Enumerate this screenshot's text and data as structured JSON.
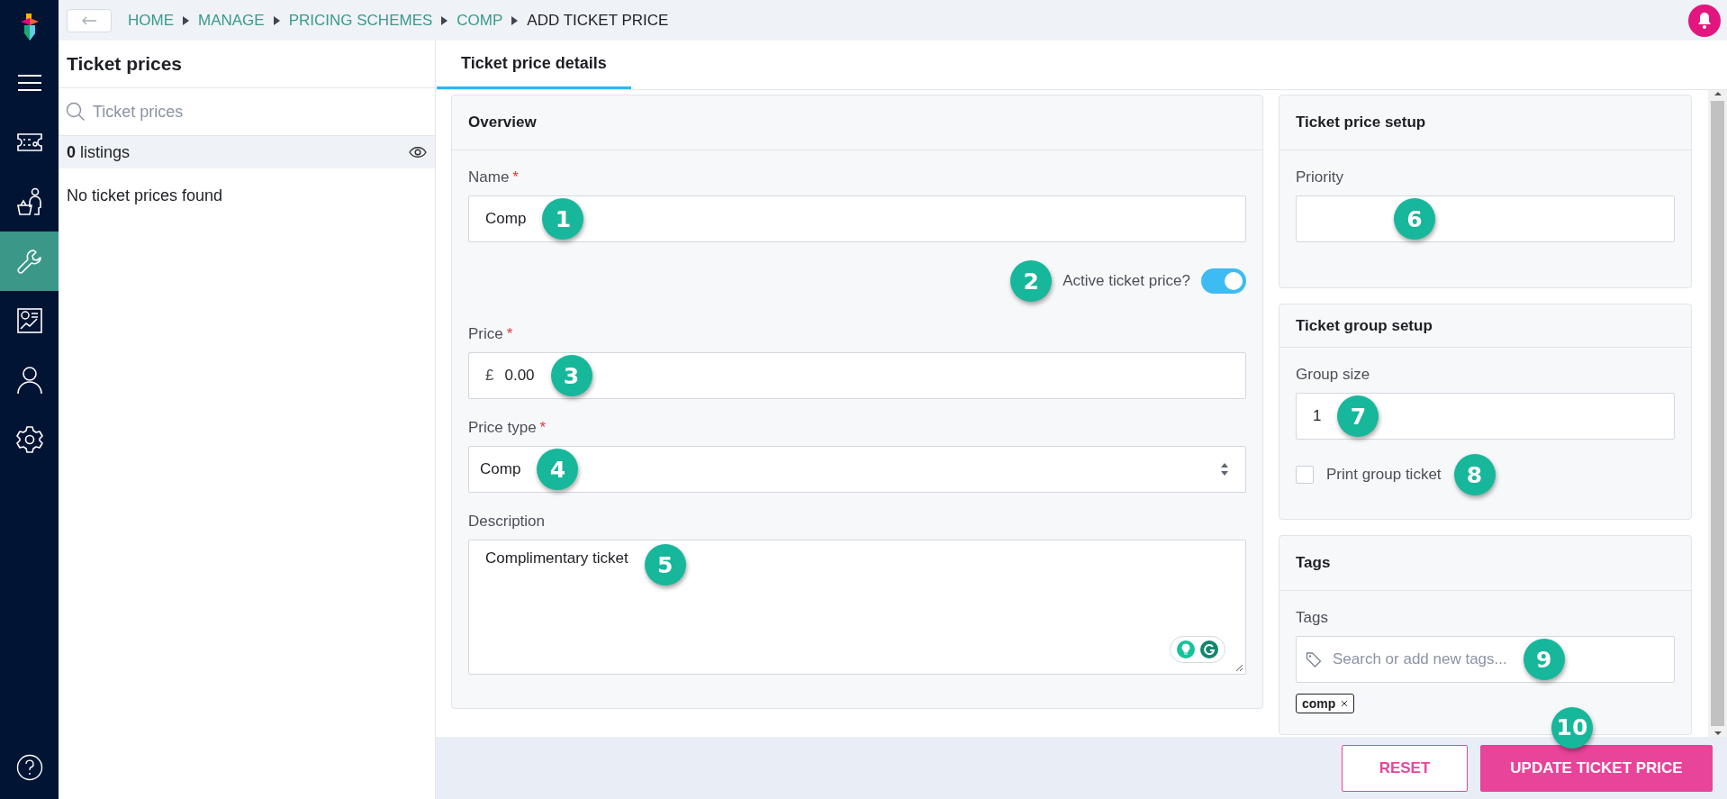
{
  "nav_items": [
    {
      "kind": "menu",
      "selected": false
    },
    {
      "kind": "ticket",
      "selected": false
    },
    {
      "kind": "basket",
      "selected": false
    },
    {
      "kind": "wrench",
      "selected": true
    },
    {
      "kind": "report",
      "selected": false
    },
    {
      "kind": "person",
      "selected": false
    },
    {
      "kind": "settings",
      "selected": false
    },
    {
      "kind": "help",
      "selected": false
    }
  ],
  "breadcrumbs": [
    {
      "label": "HOME",
      "current": false
    },
    {
      "label": "MANAGE",
      "current": false
    },
    {
      "label": "PRICING SCHEMES",
      "current": false
    },
    {
      "label": "COMP",
      "current": false
    },
    {
      "label": "ADD TICKET PRICE",
      "current": true
    }
  ],
  "list_panel": {
    "title": "Ticket prices",
    "search_placeholder": "Ticket prices",
    "count": "**0** listings",
    "empty_text": "No ticket prices found"
  },
  "tabs": [
    {
      "label": "Ticket price details",
      "selected": true
    }
  ],
  "overview": {
    "title": "Overview",
    "fields": [
      {
        "kind": "text",
        "label": "Name",
        "required_mark": "*",
        "value": "Comp",
        "callout": "1"
      },
      {
        "kind": "toggle",
        "label": "Active ticket price?",
        "on": true,
        "callout": "2"
      },
      {
        "kind": "currency",
        "label": "Price",
        "required_mark": "*",
        "prefix": "£",
        "value": "0.00",
        "callout": "3"
      },
      {
        "kind": "select",
        "label": "Price type",
        "required_mark": "*",
        "value": "Comp",
        "callout": "4"
      },
      {
        "kind": "textarea",
        "label": "Description",
        "value": "Complimentary ticket",
        "callout": "5"
      }
    ]
  },
  "side_cards": [
    {
      "title": "Ticket price setup",
      "fields": [
        {
          "kind": "text",
          "label": "Priority",
          "callout": "6"
        }
      ]
    },
    {
      "title": "Ticket group setup",
      "fields": [
        {
          "kind": "text",
          "label": "Group size",
          "value": "1",
          "callout": "7"
        },
        {
          "kind": "checkbox",
          "label": "Print group ticket",
          "checked": false,
          "callout": "8"
        }
      ]
    },
    {
      "title": "Tags",
      "fields": [
        {
          "kind": "tags",
          "label": "Tags",
          "placeholder": "Search or add new tags...",
          "callout": "9",
          "tags": [
            "comp"
          ]
        }
      ]
    }
  ],
  "buttons": [
    {
      "kind": "secondary",
      "label": "RESET"
    },
    {
      "kind": "primary",
      "label": "UPDATE TICKET PRICE",
      "callout": "10"
    }
  ]
}
